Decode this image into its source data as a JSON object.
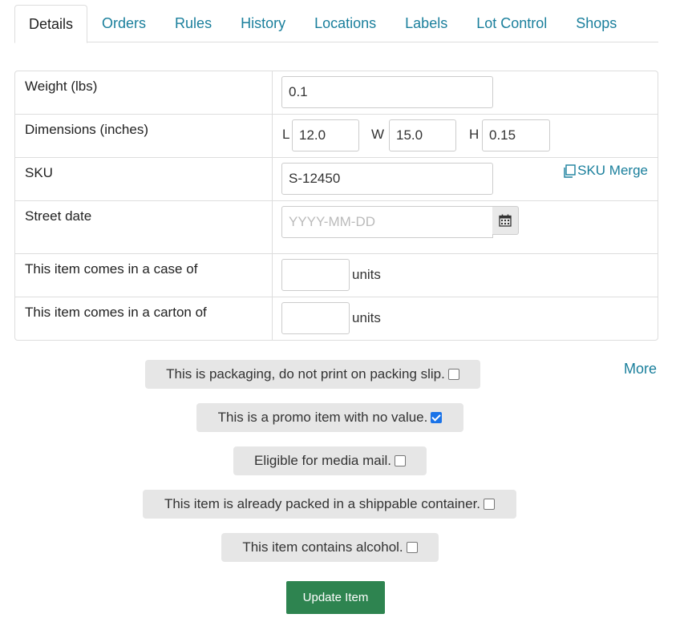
{
  "tabs": [
    {
      "label": "Details",
      "active": true
    },
    {
      "label": "Orders"
    },
    {
      "label": "Rules"
    },
    {
      "label": "History"
    },
    {
      "label": "Locations"
    },
    {
      "label": "Labels"
    },
    {
      "label": "Lot Control"
    },
    {
      "label": "Shops"
    }
  ],
  "form": {
    "weight": {
      "label": "Weight (lbs)",
      "value": "0.1"
    },
    "dimensions": {
      "label": "Dimensions (inches)",
      "l_label": "L",
      "l_value": "12.0",
      "w_label": "W",
      "w_value": "15.0",
      "h_label": "H",
      "h_value": "0.15"
    },
    "sku": {
      "label": "SKU",
      "value": "S-12450",
      "merge_label": "SKU Merge"
    },
    "street_date": {
      "label": "Street date",
      "placeholder": "YYYY-MM-DD"
    },
    "case": {
      "label": "This item comes in a case of",
      "value": "",
      "units": "units"
    },
    "carton": {
      "label": "This item comes in a carton of",
      "value": "",
      "units": "units"
    }
  },
  "options": [
    {
      "label": "This is packaging, do not print on packing slip.",
      "checked": false
    },
    {
      "label": "This is a promo item with no value.",
      "checked": true
    },
    {
      "label": "Eligible for media mail.",
      "checked": false
    },
    {
      "label": "This item is already packed in a shippable container.",
      "checked": false
    },
    {
      "label": "This item contains alcohol.",
      "checked": false
    }
  ],
  "more_label": "More",
  "update_button": "Update Item",
  "colors": {
    "link": "#1a7f9c",
    "primary": "#2e8450",
    "checkbox": "#1a73e8"
  }
}
